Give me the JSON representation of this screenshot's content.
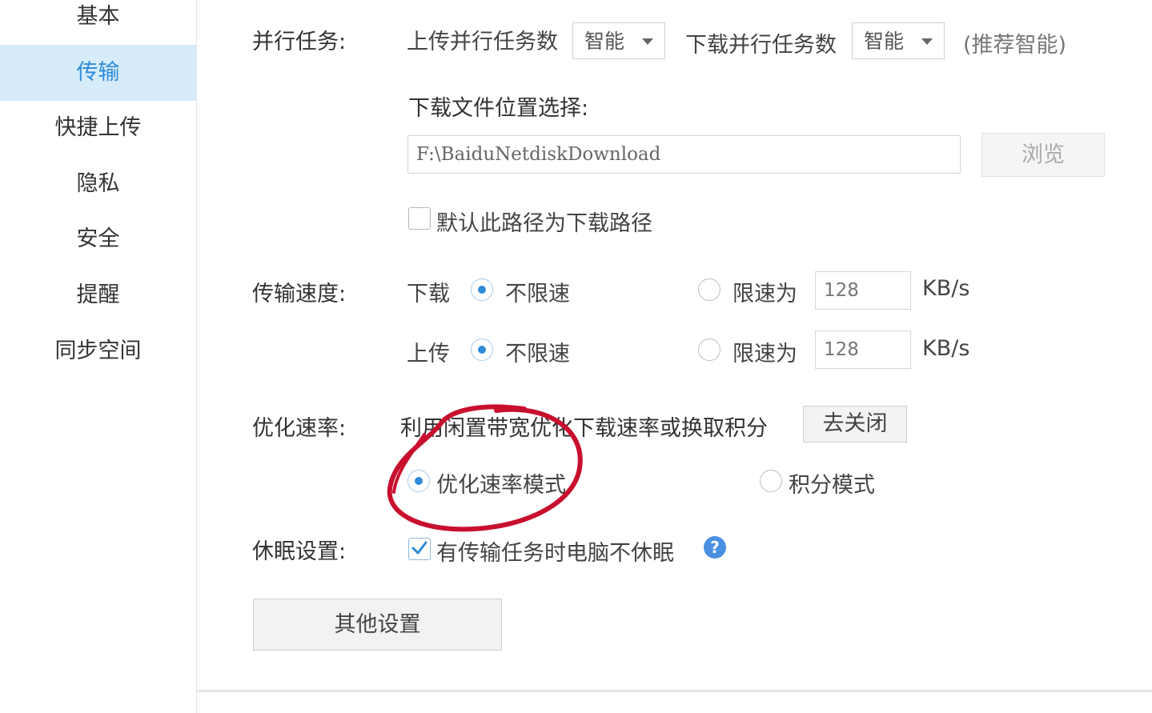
{
  "sidebar": {
    "items": [
      {
        "label": "基本",
        "active": false
      },
      {
        "label": "传输",
        "active": true
      },
      {
        "label": "快捷上传",
        "active": false
      },
      {
        "label": "隐私",
        "active": false
      },
      {
        "label": "安全",
        "active": false
      },
      {
        "label": "提醒",
        "active": false
      },
      {
        "label": "同步空间",
        "active": false
      }
    ]
  },
  "parallel": {
    "label": "并行任务:",
    "upload_label": "上传并行任务数",
    "upload_value": "智能",
    "download_label": "下载并行任务数",
    "download_value": "智能",
    "hint": "(推荐智能)"
  },
  "download_location": {
    "label": "下载文件位置选择:",
    "path": "F:\\BaiduNetdiskDownload",
    "browse_label": "浏览",
    "default_checkbox_label": "默认此路径为下载路径",
    "default_checked": false
  },
  "speed": {
    "label": "传输速度:",
    "download": {
      "label": "下载",
      "unlimited_label": "不限速",
      "limit_label": "限速为",
      "limit_value": "128",
      "unit": "KB/s",
      "unlimited_selected": true
    },
    "upload": {
      "label": "上传",
      "unlimited_label": "不限速",
      "limit_label": "限速为",
      "limit_value": "128",
      "unit": "KB/s",
      "unlimited_selected": true
    }
  },
  "optimize": {
    "label": "优化速率:",
    "description": "利用闲置带宽优化下载速率或换取积分",
    "close_button": "去关闭",
    "mode_speed_label": "优化速率模式",
    "mode_points_label": "积分模式",
    "selected_mode": "speed"
  },
  "sleep": {
    "label": "休眠设置:",
    "checkbox_label": "有传输任务时电脑不休眠",
    "checked": true,
    "help_icon": "?"
  },
  "other_settings_label": "其他设置",
  "colors": {
    "accent": "#2e8bd8",
    "active_nav_bg": "#d6ecfb",
    "annotation_red": "#c8102e"
  }
}
